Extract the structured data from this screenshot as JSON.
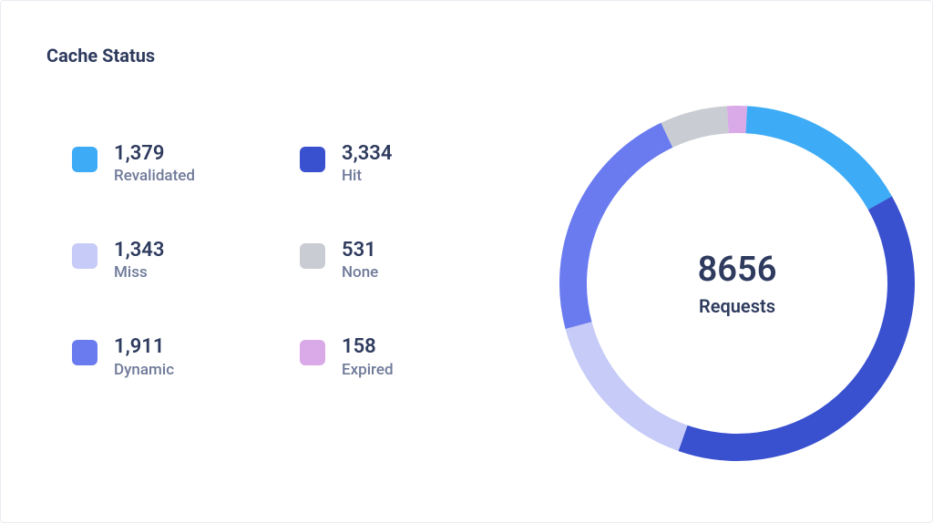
{
  "title": "Cache Status",
  "total_value": "8656",
  "total_label": "Requests",
  "legend": [
    {
      "name": "Revalidated",
      "value": 1379,
      "display_value": "1,379",
      "color": "#3dabf5"
    },
    {
      "name": "Hit",
      "value": 3334,
      "display_value": "3,334",
      "color": "#3950cf"
    },
    {
      "name": "Miss",
      "value": 1343,
      "display_value": "1,343",
      "color": "#c6cbf7"
    },
    {
      "name": "None",
      "value": 531,
      "display_value": "531",
      "color": "#c9ccd2"
    },
    {
      "name": "Dynamic",
      "value": 1911,
      "display_value": "1,911",
      "color": "#6a7bf0"
    },
    {
      "name": "Expired",
      "value": 158,
      "display_value": "158",
      "color": "#d9a9e8"
    }
  ],
  "donut_order": [
    "Expired",
    "Revalidated",
    "Hit",
    "Miss",
    "Dynamic",
    "None"
  ],
  "chart_data": {
    "type": "pie",
    "title": "Cache Status",
    "series": [
      {
        "name": "Revalidated",
        "value": 1379,
        "color": "#3dabf5"
      },
      {
        "name": "Hit",
        "value": 3334,
        "color": "#3950cf"
      },
      {
        "name": "Miss",
        "value": 1343,
        "color": "#c6cbf7"
      },
      {
        "name": "None",
        "value": 531,
        "color": "#c9ccd2"
      },
      {
        "name": "Dynamic",
        "value": 1911,
        "color": "#6a7bf0"
      },
      {
        "name": "Expired",
        "value": 158,
        "color": "#d9a9e8"
      }
    ],
    "total": 8656,
    "center_label": "Requests"
  }
}
